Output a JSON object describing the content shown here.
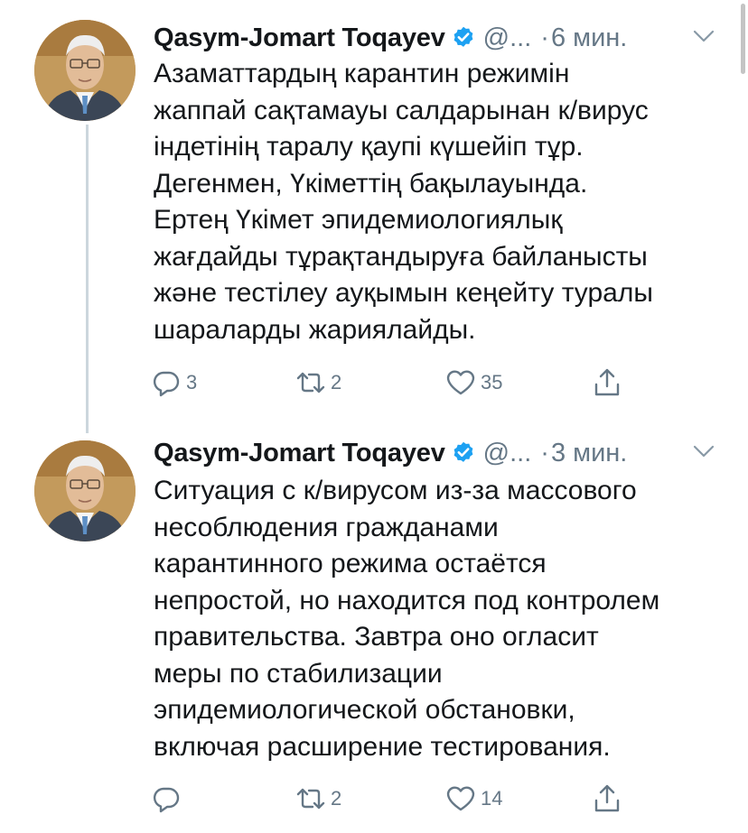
{
  "colors": {
    "text": "#14171a",
    "secondary": "#657786",
    "verified": "#1da1f2",
    "thread_line": "#ccd6dd"
  },
  "icons": {
    "verified": "verified-badge-icon",
    "menu": "chevron-down-icon",
    "reply": "reply-icon",
    "retweet": "retweet-icon",
    "like": "heart-icon",
    "share": "share-icon"
  },
  "tweets": [
    {
      "author_name": "Qasym-Jomart Toqayev",
      "handle": "@...",
      "separator": "·",
      "time": "6 мин.",
      "text": "Азаматтардың карантин режимін\nжаппай сақтамауы салдарынан к/вирус\nіндетінің таралу қаупі күшейіп тұр.\nДегенмен, Үкіметтің бақылауында.\nЕртең Үкімет эпидемиологиялық\nжағдайды тұрақтандыруға байланысты\nжәне тестілеу ауқымын кеңейту туралы\nшараларды жариялайды.",
      "replies": "3",
      "retweets": "2",
      "likes": "35"
    },
    {
      "author_name": "Qasym-Jomart Toqayev",
      "handle": "@...",
      "separator": "·",
      "time": "3 мин.",
      "text": "Ситуация с к/вирусом из-за массового\nнесоблюдения гражданами\nкарантинного режима остаётся\nнепростой, но находится под контролем\nправительства. Завтра оно огласит\nмеры по стабилизации\nэпидемиологической обстановки,\nвключая расширение тестирования.",
      "replies": "",
      "retweets": "2",
      "likes": "14"
    }
  ]
}
